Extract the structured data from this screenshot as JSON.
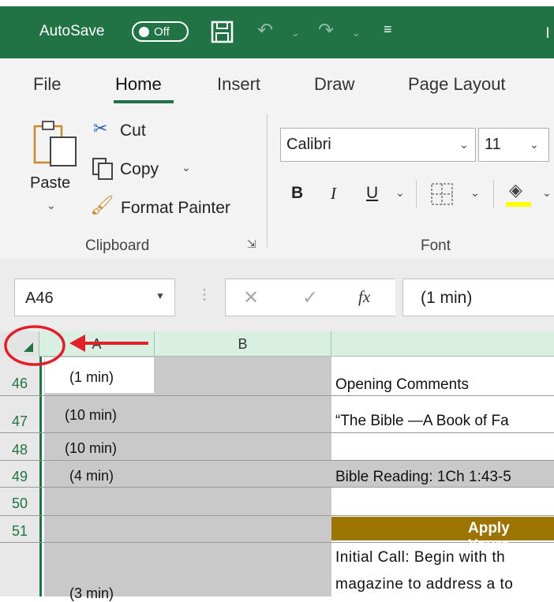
{
  "titlebar": {
    "autosave_label": "AutoSave",
    "autosave_state": "Off",
    "title_fragment": "l"
  },
  "ribbon": {
    "tabs": [
      "File",
      "Home",
      "Insert",
      "Draw",
      "Page Layout"
    ],
    "active_tab": "Home",
    "clipboard": {
      "paste": "Paste",
      "cut": "Cut",
      "copy": "Copy",
      "format_painter": "Format Painter",
      "group_label": "Clipboard"
    },
    "font": {
      "name": "Calibri",
      "size": "11",
      "bold": "B",
      "italic": "I",
      "underline": "U",
      "group_label": "Font"
    }
  },
  "formula_bar": {
    "name_box": "A46",
    "content": "(1 min)"
  },
  "grid": {
    "columns": [
      "A",
      "B"
    ],
    "rows": [
      {
        "num": "46",
        "a": "(1 min)",
        "c": "Opening Comments"
      },
      {
        "num": "47",
        "a": "(10 min)",
        "c": "“The Bible —A Book of Fa"
      },
      {
        "num": "48",
        "a": "(10 min)",
        "c": ""
      },
      {
        "num": "49",
        "a": "(4 min)",
        "c": "Bible Reading:  1Ch 1:43-5"
      },
      {
        "num": "50",
        "a": "",
        "c": ""
      },
      {
        "num": "51",
        "a": "",
        "c": ""
      }
    ],
    "apply_header": "Apply Yours",
    "text_line1": "Initial Call:  Begin with th",
    "text_line2": "magazine to address a to",
    "bottom_a": "(3 min)"
  },
  "colors": {
    "excel_green": "#217346",
    "annotation_red": "#e3202a",
    "apply_header_bg": "#9c7500"
  }
}
